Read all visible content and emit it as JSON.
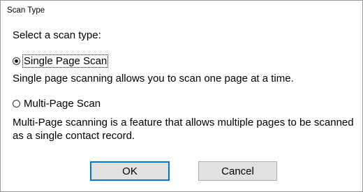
{
  "dialog": {
    "title": "Scan Type",
    "prompt": "Select a scan type:"
  },
  "options": [
    {
      "label": "Single Page Scan",
      "selected": true,
      "description": "Single page scanning allows you to scan one page at a time."
    },
    {
      "label": "Multi-Page Scan",
      "selected": false,
      "description": "Multi-Page scanning is a feature that allows multiple pages to be scanned as a single contact record."
    }
  ],
  "buttons": {
    "ok_label": "OK",
    "cancel_label": "Cancel"
  },
  "colors": {
    "accent": "#0078d7",
    "button_face": "#e1e1e1",
    "button_border": "#adadad"
  }
}
